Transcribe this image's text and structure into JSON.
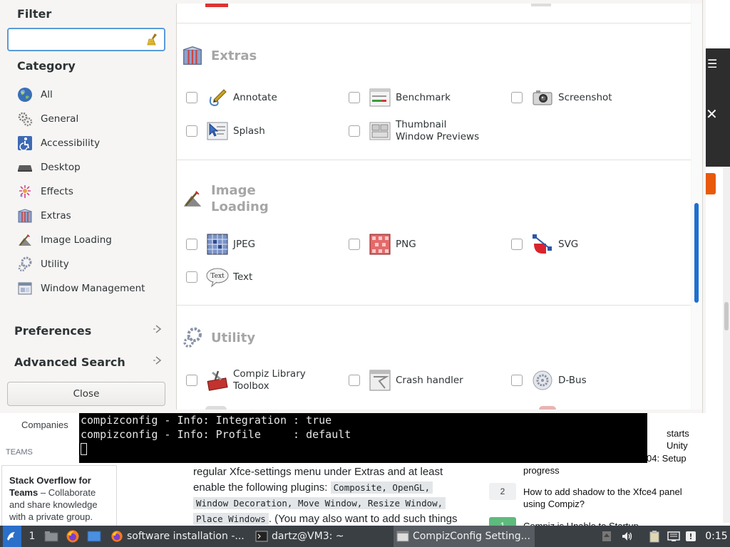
{
  "filter": {
    "title": "Filter",
    "input_value": ""
  },
  "category": {
    "title": "Category",
    "items": [
      {
        "label": "All",
        "icon": "globe-icon"
      },
      {
        "label": "General",
        "icon": "gears-icon"
      },
      {
        "label": "Accessibility",
        "icon": "accessibility-icon"
      },
      {
        "label": "Desktop",
        "icon": "desktop-icon"
      },
      {
        "label": "Effects",
        "icon": "effects-icon"
      },
      {
        "label": "Extras",
        "icon": "extras-icon"
      },
      {
        "label": "Image Loading",
        "icon": "image-loading-icon"
      },
      {
        "label": "Utility",
        "icon": "utility-icon"
      },
      {
        "label": "Window Management",
        "icon": "window-management-icon"
      }
    ]
  },
  "sections": {
    "preferences": "Preferences",
    "advanced_search": "Advanced Search",
    "close": "Close"
  },
  "groups": {
    "extras": {
      "title": "Extras",
      "plugins": [
        {
          "label": "Annotate",
          "icon": "annotate-icon"
        },
        {
          "label": "Benchmark",
          "icon": "benchmark-icon"
        },
        {
          "label": "Screenshot",
          "icon": "camera-icon"
        },
        {
          "label": "Splash",
          "icon": "splash-icon"
        },
        {
          "label_line1": "Thumbnail",
          "label_line2": "Window Previews",
          "icon": "thumbnail-icon"
        }
      ]
    },
    "image_loading": {
      "title_line1": "Image",
      "title_line2": "Loading",
      "plugins": [
        {
          "label": "JPEG",
          "icon": "jpeg-icon"
        },
        {
          "label": "PNG",
          "icon": "png-icon"
        },
        {
          "label": "SVG",
          "icon": "svg-icon"
        },
        {
          "label": "Text",
          "icon": "text-icon"
        }
      ]
    },
    "utility": {
      "title": "Utility",
      "plugins": [
        {
          "label_line1": "Compiz Library",
          "label_line2": "Toolbox",
          "icon": "toolbox-icon"
        },
        {
          "label": "Crash handler",
          "icon": "crash-handler-icon"
        },
        {
          "label": "D-Bus",
          "icon": "dbus-icon"
        }
      ]
    }
  },
  "terminal": {
    "line1": "compizconfig - Info: Integration : true",
    "line2": "compizconfig - Info: Profile     : default"
  },
  "background_page": {
    "companies": "Companies",
    "teams": "TEAMS",
    "team_box_bold": "Stack Overflow for Teams",
    "team_box_text": " – Collaborate and share knowledge with a private group.",
    "body_text1": "regular Xfce-settings menu under Extras and at least enable the following plugins: ",
    "code1": "Composite, OpenGL,",
    "code2": "Window Decoration, Move Window, Resize Window,",
    "code3": "Place Windows",
    "body_text2": ". (You may also want to add such things",
    "related": [
      {
        "text": "starts Unity"
      },
      {
        "text": "04: Setup progress"
      },
      {
        "count": "2",
        "text": "How to add shadow to the Xfce4 panel using Compiz?"
      },
      {
        "count": "1",
        "text": "Compiz is Unable to Startup"
      }
    ]
  },
  "taskbar": {
    "workspace": "1",
    "tasks": [
      {
        "label": "software installation -...",
        "icon": "firefox-icon"
      },
      {
        "label": "dartz@VM3: ~",
        "icon": "terminal-icon"
      },
      {
        "label": "CompizConfig Setting...",
        "icon": "compizconfig-icon"
      }
    ],
    "clock": "0:15"
  }
}
